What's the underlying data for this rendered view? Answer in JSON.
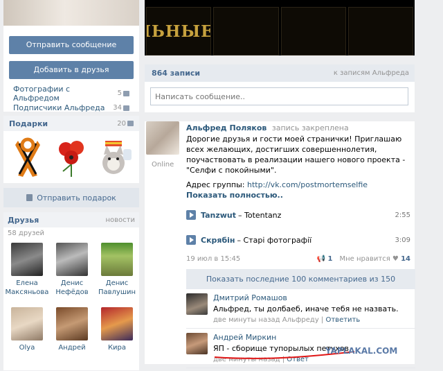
{
  "left": {
    "actions": {
      "message": "Отправить сообщение",
      "add_friend": "Добавить в друзья"
    },
    "stats": [
      {
        "label": "Фотографии с Альфредом",
        "count": "5"
      },
      {
        "label": "Подписчики Альфреда",
        "count": "34"
      }
    ],
    "gifts": {
      "title": "Подарки",
      "count": "20",
      "send": "Отправить подарок"
    },
    "friends": {
      "title": "Друзья",
      "link": "новости",
      "count": "58 друзей",
      "items": [
        {
          "name": "Елена Максяньова"
        },
        {
          "name": "Денис Нефёдов"
        },
        {
          "name": "Денис Павлушин"
        },
        {
          "name": "Olya"
        },
        {
          "name": "Андрей"
        },
        {
          "name": "Кира"
        }
      ]
    }
  },
  "banner": {
    "text": "РИТУАЛЬНЫЕ УСЛУГИ"
  },
  "wall": {
    "count": "864 записи",
    "link": "к записям Альфреда",
    "placeholder": "Написать сообщение.."
  },
  "post": {
    "online": "Online",
    "author": "Альфред Поляков",
    "pinned": "запись закреплена",
    "text": "Дорогие друзья и гости моей странички! Приглашаю всех желающих, достигших совершеннолетия, поучаствовать в реализации нашего нового проекта - \"Селфи с покойными\".",
    "link_prefix": "Адрес группы:",
    "link": "http://vk.com/postmortemselfie",
    "more": "Показать полностью..",
    "tracks": [
      {
        "artist": "Tanzwut",
        "song": "– Totentanz",
        "duration": "2:55"
      },
      {
        "artist": "Скрябін",
        "song": "– Старі фотографії",
        "duration": "3:09"
      }
    ],
    "date": "19 июл в 15:45",
    "shares": "1",
    "like_label": "Мне нравится",
    "likes": "14",
    "show_comments": "Показать последние 100 комментариев из 150"
  },
  "comments": [
    {
      "author": "Дмитрий Ромашов",
      "text": "Альфред, ты долбаеб, иначе тебя не назвать.",
      "time": "две минуты назад Альфреду",
      "reply": "Ответить"
    },
    {
      "author": "Андрей Миркин",
      "text": "ЯП - сборище тупорылых петухов",
      "time": "две минуты назад",
      "reply": "Ответ"
    }
  ],
  "watermark": "YAPLAKAL.COM"
}
